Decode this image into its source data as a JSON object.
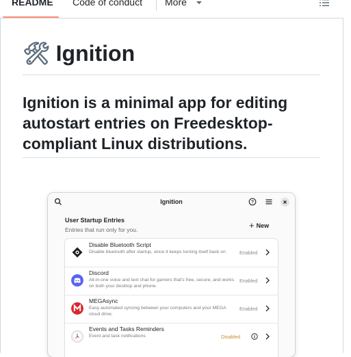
{
  "tabs": {
    "readme": "README",
    "conduct": "Code of conduct",
    "more": "More"
  },
  "readme": {
    "title_emoji": "🛠",
    "title": "Ignition",
    "subtitle": "Ignition is a minimal app for editing autostart entries on Freedesktop-compliant Linux distributions."
  },
  "app": {
    "title": "Ignition",
    "section_title": "User Startup Entries",
    "section_subtitle": "Entries that run only for you.",
    "new_label": "New",
    "entries": [
      {
        "name": "Disable Bluetooth Script",
        "description": "Disable bluetooth after startup, since it keeps turning itself back on",
        "status": "Enabled",
        "icon": "script-gear-icon",
        "icon_color": "#1f1f1f"
      },
      {
        "name": "Discord",
        "description": "All-in-one voice and text chat for gamers that's free, secure, and works on both your desktop and phone.",
        "status": "Enabled",
        "icon": "discord-icon",
        "icon_color": "#5865f2"
      },
      {
        "name": "MEGAsync",
        "description": "Easy automated syncing between your computers and your MEGA cloud drive.",
        "status": "Enabled",
        "icon": "mega-icon",
        "icon_color": "#d9272e"
      },
      {
        "name": "Events and Tasks Reminders",
        "description": "Event and task notifications",
        "status": "Disabled",
        "icon": "clock-icon",
        "icon_color": "#eeeeee"
      }
    ]
  },
  "colors": {
    "tab_underline": "#fd8c73",
    "disabled_status": "#c88a3a"
  }
}
